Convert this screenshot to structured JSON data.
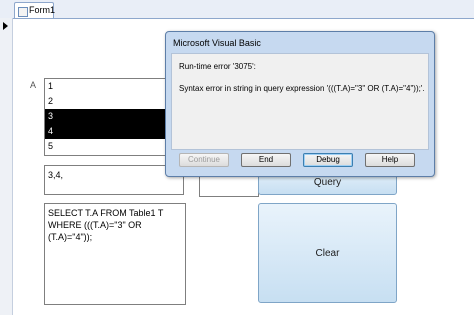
{
  "tabs": [
    {
      "label": "Form1"
    }
  ],
  "form": {
    "field_label": "A",
    "list_items": [
      "1",
      "2",
      "3",
      "4",
      "5"
    ],
    "selected_items": [
      "3",
      "4"
    ],
    "selection_text": "3,4,",
    "sql_text": "SELECT T.A FROM Table1 T WHERE (((T.A)=\"3\" OR (T.A)=\"4\"));",
    "query_button": "Query",
    "clear_button": "Clear"
  },
  "dialog": {
    "title": "Microsoft Visual Basic",
    "error_code": "Run-time error '3075':",
    "error_message": "Syntax error in string in query expression '(((T.A)=\"3\" OR (T.A)=\"4\"));'.",
    "buttons": {
      "continue": "Continue",
      "end": "End",
      "debug": "Debug",
      "help": "Help"
    }
  }
}
